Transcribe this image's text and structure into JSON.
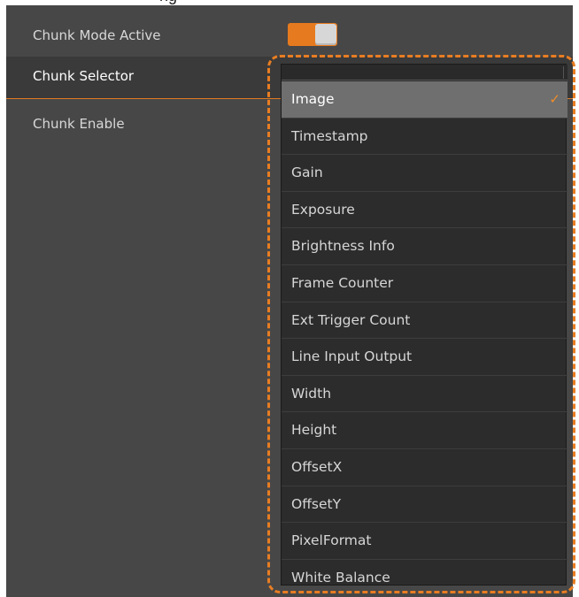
{
  "header": {
    "cut_text": "ng"
  },
  "properties": {
    "chunk_mode_active": {
      "label": "Chunk Mode Active",
      "enabled": true
    },
    "chunk_selector": {
      "label": "Chunk Selector"
    },
    "chunk_enable": {
      "label": "Chunk Enable"
    }
  },
  "dropdown": {
    "selected": "Image",
    "check_glyph": "✓",
    "options": [
      "Image",
      "Timestamp",
      "Gain",
      "Exposure",
      "Brightness Info",
      "Frame Counter",
      "Ext Trigger Count",
      "Line Input Output",
      "Width",
      "Height",
      "OffsetX",
      "OffsetY",
      "PixelFormat",
      "White Balance"
    ]
  },
  "colors": {
    "accent": "#e87d22",
    "panel_bg": "#474747",
    "dropdown_bg": "#2c2c2c",
    "selected_bg": "#6f6f6f"
  }
}
